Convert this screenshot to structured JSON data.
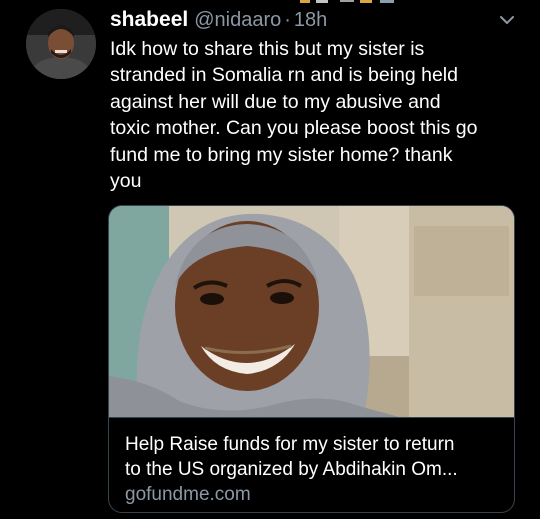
{
  "tweet": {
    "display_name": "shabeel",
    "handle": "@nidaaro",
    "separator": "·",
    "time": "18h",
    "text_lines": [
      "Idk how to share this but my sister is",
      "stranded in Somalia rn and is being held",
      "against her will due to my abusive and",
      "toxic mother. Can you please boost this go",
      "fund me to bring my sister home? thank",
      "you"
    ],
    "icons": {
      "more": "chevron-down-icon",
      "avatar": "profile-avatar"
    }
  },
  "card": {
    "title_lines": [
      "Help Raise funds for my sister to return",
      "to the US organized by Abdihakin Om..."
    ],
    "domain": "gofundme.com"
  },
  "colors": {
    "background": "#000000",
    "primary_text": "#ffffff",
    "secondary_text": "#8b98a5",
    "border": "#38444d"
  }
}
